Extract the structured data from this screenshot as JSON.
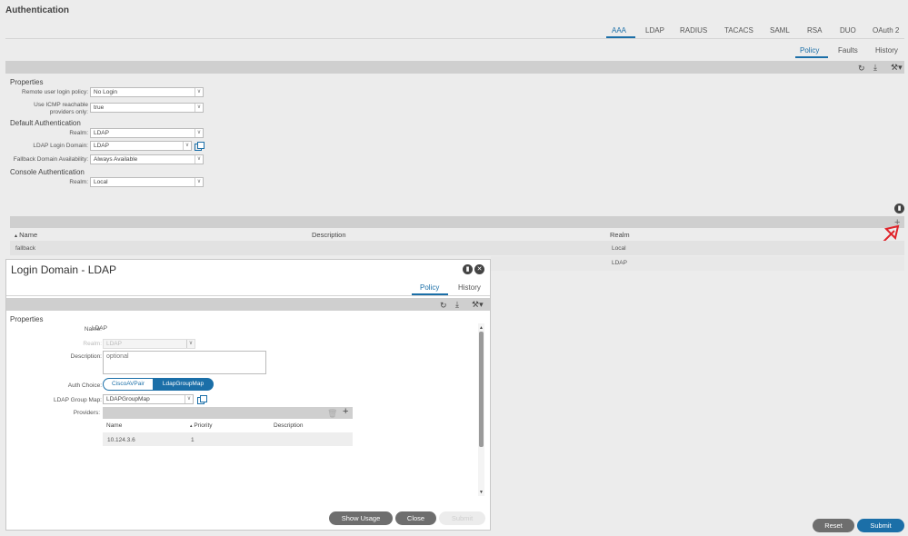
{
  "header": {
    "title": "Authentication"
  },
  "main_tabs": [
    {
      "label": "AAA"
    },
    {
      "label": "LDAP"
    },
    {
      "label": "RADIUS"
    },
    {
      "label": "TACACS"
    },
    {
      "label": "SAML"
    },
    {
      "label": "RSA"
    },
    {
      "label": "DUO"
    },
    {
      "label": "OAuth 2"
    }
  ],
  "sub_tabs": [
    {
      "label": "Policy"
    },
    {
      "label": "Faults"
    },
    {
      "label": "History"
    }
  ],
  "properties": {
    "heading": "Properties",
    "remote_login_label": "Remote user login policy:",
    "remote_login_value": "No Login",
    "icmp_label_1": "Use ICMP reachable",
    "icmp_label_2": "providers only:",
    "icmp_value": "true",
    "default_auth_heading": "Default Authentication",
    "realm_label": "Realm:",
    "realm_value": "LDAP",
    "ldap_domain_label": "LDAP Login Domain:",
    "ldap_domain_value": "LDAP",
    "fallback_label": "Fallback Domain Availability:",
    "fallback_value": "Always Available",
    "console_auth_heading": "Console Authentication",
    "console_realm_label": "Realm:",
    "console_realm_value": "Local"
  },
  "domains_table": {
    "columns": [
      "Name",
      "Description",
      "Realm"
    ],
    "rows": [
      {
        "name": "fallback",
        "description": "",
        "realm": "Local"
      },
      {
        "name": "",
        "description": "",
        "realm": "LDAP"
      }
    ]
  },
  "dialog": {
    "title": "Login Domain - LDAP",
    "tabs": [
      "Policy",
      "History"
    ],
    "properties_heading": "Properties",
    "name_label": "Name:",
    "name_value": "LDAP",
    "realm_label": "Realm:",
    "realm_value": "LDAP",
    "description_label": "Description:",
    "description_placeholder": "optional",
    "auth_choice_label": "Auth Choice:",
    "auth_choice_options": [
      "CiscoAVPair",
      "LdapGroupMap"
    ],
    "auth_choice_selected": "LdapGroupMap",
    "group_map_label": "LDAP Group Map:",
    "group_map_value": "LDAPGroupMap",
    "providers_label": "Providers:",
    "providers_columns": [
      "Name",
      "Priority",
      "Description"
    ],
    "providers_rows": [
      {
        "name": "10.124.3.6",
        "priority": "1",
        "description": ""
      }
    ],
    "buttons": {
      "show_usage": "Show Usage",
      "close": "Close",
      "submit": "Submit"
    }
  },
  "footer": {
    "reset": "Reset",
    "submit": "Submit"
  },
  "colors": {
    "accent": "#1b6fa8",
    "annotation_arrow": "#e0242b"
  }
}
